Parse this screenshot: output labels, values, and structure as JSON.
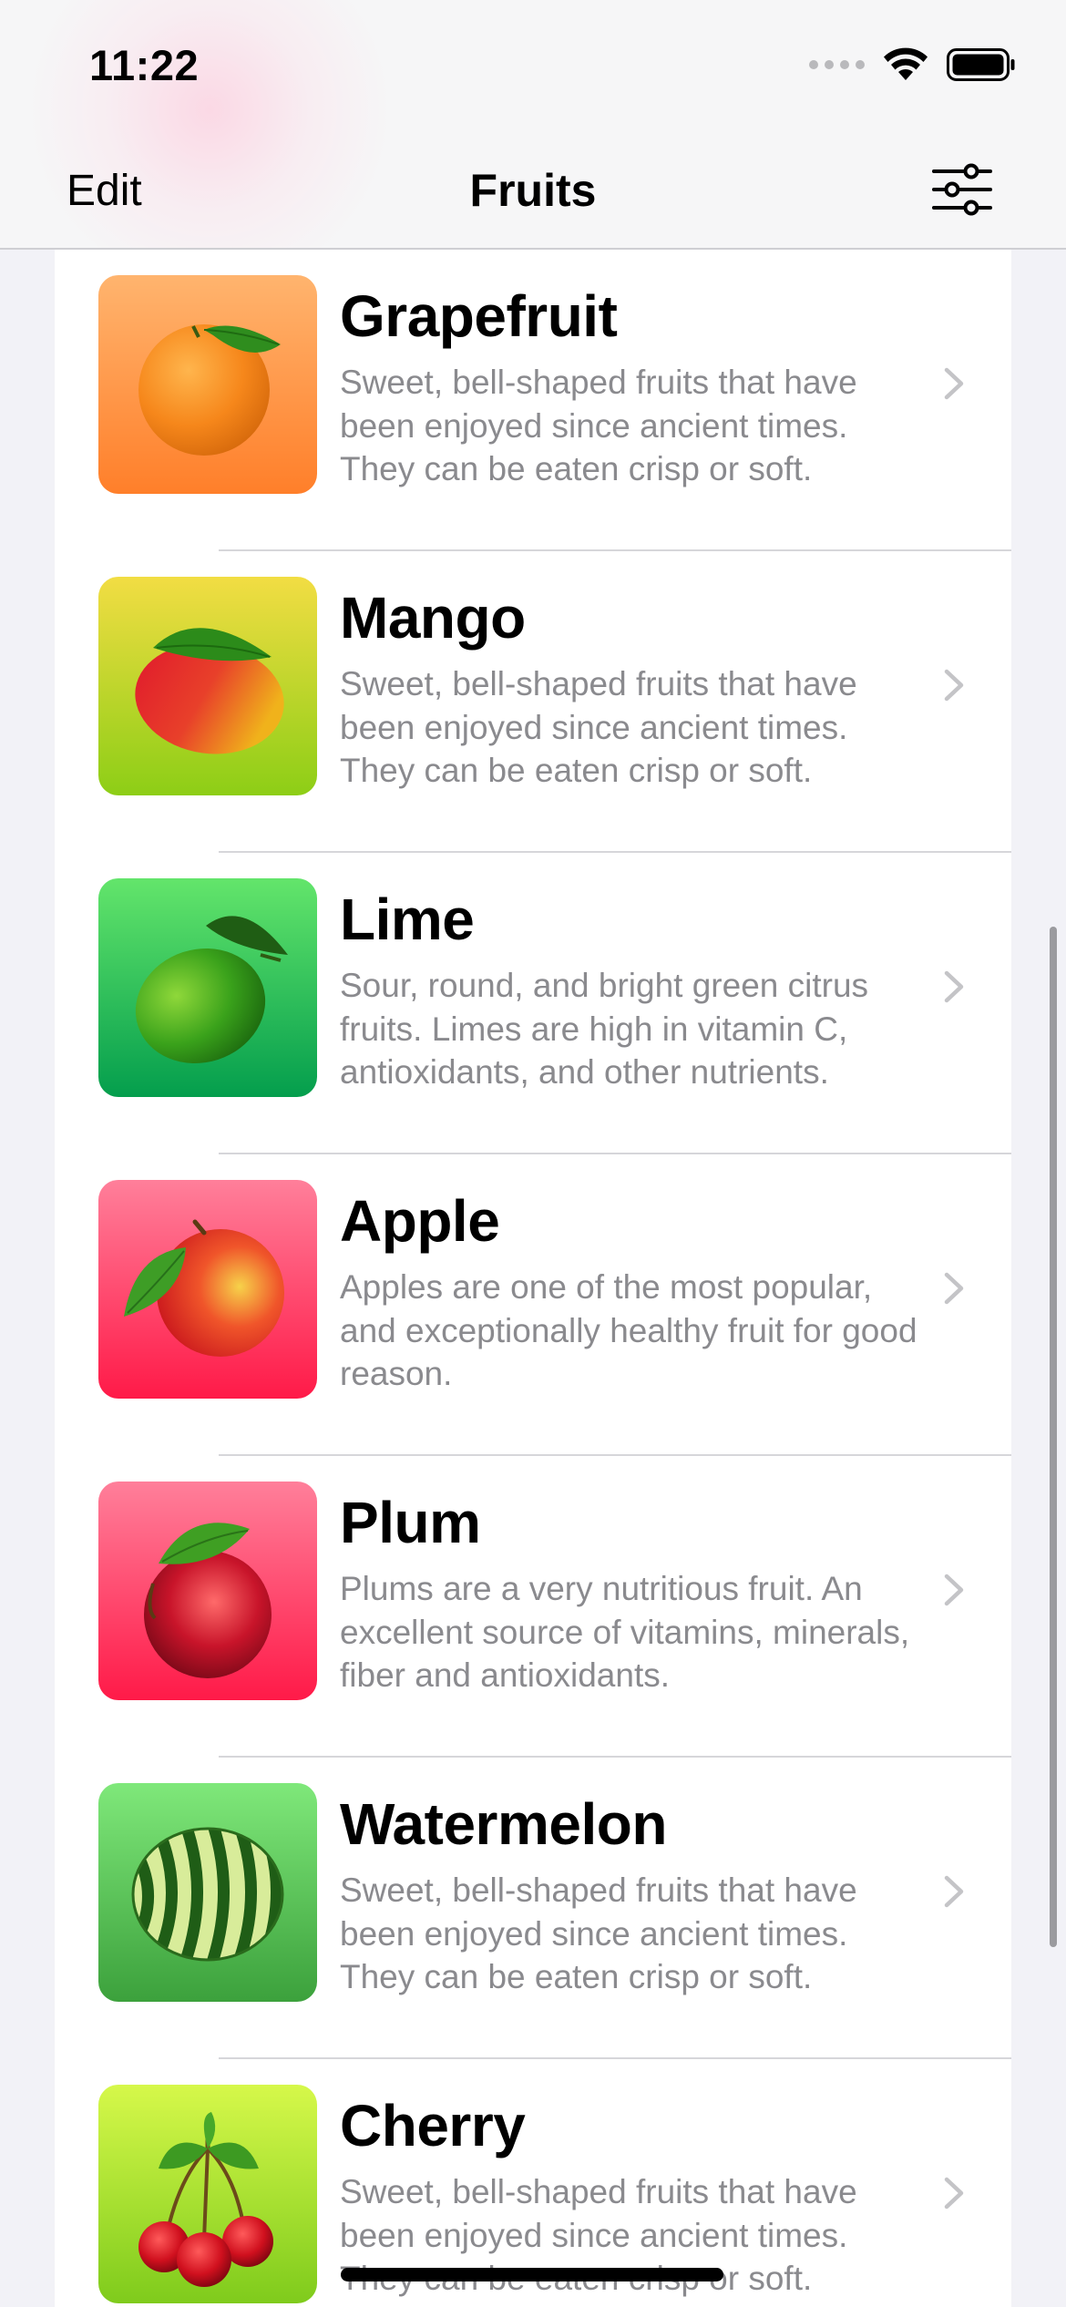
{
  "status_bar": {
    "time": "11:22"
  },
  "nav": {
    "edit_label": "Edit",
    "title": "Fruits",
    "filter_icon": "sliders-icon"
  },
  "fruits": [
    {
      "name": "Grapefruit",
      "description": "Sweet, bell-shaped fruits that have been enjoyed since ancient times. They can be eaten crisp or soft.",
      "gradient_top": "#ffb46e",
      "gradient_bottom": "#ff7f2a"
    },
    {
      "name": "Mango",
      "description": "Sweet, bell-shaped fruits that have been enjoyed since ancient times. They can be eaten crisp or soft.",
      "gradient_top": "#f2dd43",
      "gradient_bottom": "#8dce16"
    },
    {
      "name": "Lime",
      "description": "Sour, round, and bright green citrus fruits. Limes are high in vitamin C, antioxidants, and other nutrients.",
      "gradient_top": "#63e56b",
      "gradient_bottom": "#049e4d"
    },
    {
      "name": "Apple",
      "description": "Apples are one of the most popular, and exceptionally healthy fruit for good reason.",
      "gradient_top": "#ff7f9a",
      "gradient_bottom": "#ff1a48"
    },
    {
      "name": "Plum",
      "description": "Plums are a very nutritious fruit. An excellent source of vitamins, minerals, fiber and antioxidants.",
      "gradient_top": "#ff7f9a",
      "gradient_bottom": "#ff1a48"
    },
    {
      "name": "Watermelon",
      "description": "Sweet, bell-shaped fruits that have been enjoyed since ancient times. They can be eaten crisp or soft.",
      "gradient_top": "#7fe87a",
      "gradient_bottom": "#3ca13c"
    },
    {
      "name": "Cherry",
      "description": "Sweet, bell-shaped fruits that have been enjoyed since ancient times. They can be eaten crisp or soft.",
      "gradient_top": "#d6f84a",
      "gradient_bottom": "#7fcb1c"
    }
  ]
}
